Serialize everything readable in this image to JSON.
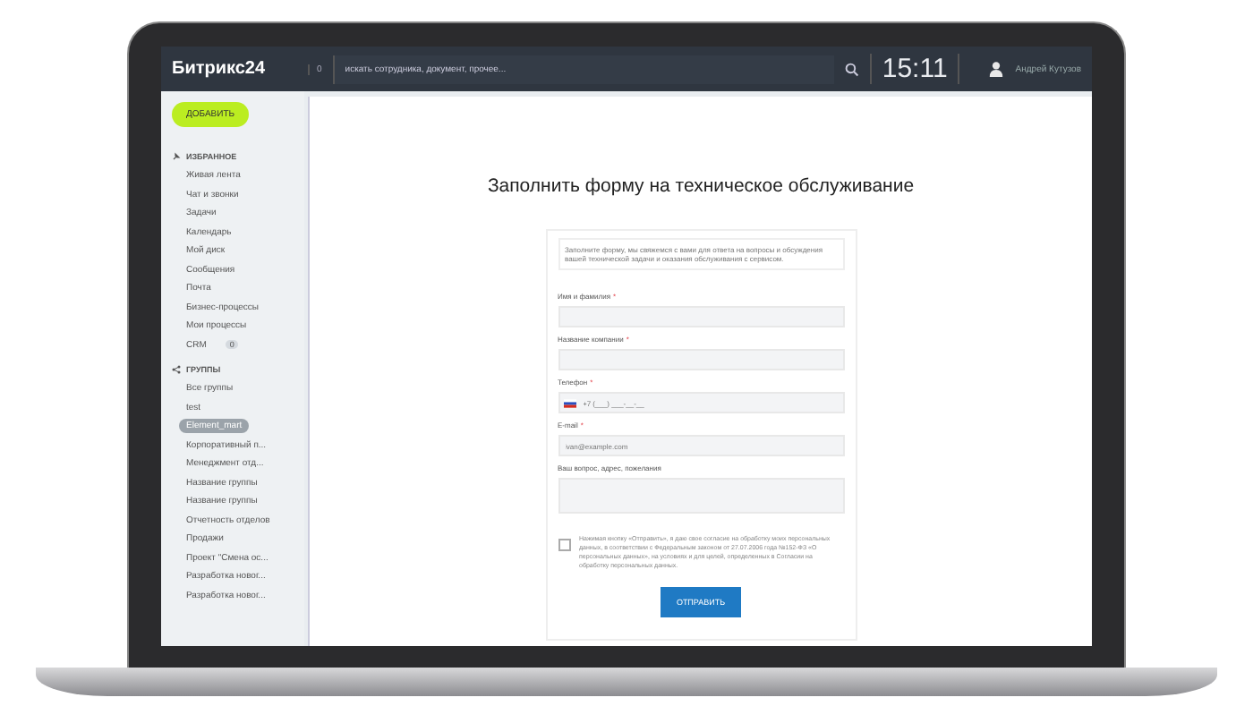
{
  "header": {
    "logo": "Битрикс24",
    "counter": "0",
    "search": {
      "placeholder": "искать сотрудника, документ, прочее..."
    },
    "time": "15:11",
    "user": "Андрей Кутузов"
  },
  "sidebar": {
    "add_button": "ДОБАВИТЬ",
    "sections": [
      {
        "title": "ИЗБРАННОЕ",
        "kind": "favorites",
        "items": [
          {
            "label": "Живая лента",
            "selected": false
          },
          {
            "label": "Чат и звонки",
            "selected": false
          },
          {
            "label": "Задачи",
            "selected": false
          },
          {
            "label": "Календарь",
            "selected": false
          },
          {
            "label": "Мой диск",
            "selected": false
          },
          {
            "label": "Сообщения",
            "selected": false
          },
          {
            "label": "Почта",
            "selected": false
          },
          {
            "label": "Бизнес-процессы",
            "selected": false
          },
          {
            "label": "Мои процессы",
            "selected": false
          },
          {
            "label": "CRM",
            "badge": "0",
            "selected": false
          }
        ]
      },
      {
        "title": "ГРУППЫ",
        "kind": "groups",
        "items": [
          {
            "label": "Все группы",
            "selected": false
          },
          {
            "label": "test",
            "selected": false
          },
          {
            "label": "Element_mart",
            "selected": true
          },
          {
            "label": "Корпоративный п...",
            "selected": false
          },
          {
            "label": "Менеджмент отд...",
            "selected": false
          },
          {
            "label": "Название группы",
            "selected": false
          },
          {
            "label": "Название группы",
            "selected": false
          },
          {
            "label": "Отчетность отделов",
            "selected": false
          },
          {
            "label": "Продажи",
            "selected": false
          },
          {
            "label": "Проект \"Смена ос...",
            "selected": false
          },
          {
            "label": "Разработка новог...",
            "selected": false
          },
          {
            "label": "Разработка новог...",
            "selected": false
          }
        ]
      }
    ]
  },
  "form": {
    "title": "Заполнить форму на техническое обслуживание",
    "intro": "Заполните форму, мы свяжемся с вами для ответа на вопросы и обсуждения вашей технической задачи и оказания обслуживания с сервисом.",
    "fields": [
      {
        "kind": "text",
        "label": "Имя и фамилия",
        "required_mark": "*"
      },
      {
        "kind": "text",
        "label": "Название компании",
        "required_mark": "*"
      },
      {
        "kind": "phone",
        "label": "Телефон",
        "required_mark": "*",
        "placeholder": "+7 (___) ___-__-__"
      },
      {
        "kind": "email",
        "label": "E-mail",
        "required_mark": "*",
        "placeholder": "ivan@example.com"
      },
      {
        "kind": "textarea",
        "label": "Ваш вопрос, адрес, пожелания"
      }
    ],
    "consent": {
      "checked": false,
      "text": "Нажимая кнопку «Отправить», я даю свое согласие на обработку моих персональных данных, в соответствии с Федеральным законом от 27.07.2006 года №152-ФЗ «О персональных данных», на условиях и для целей, определенных в Согласии на обработку персональных данных."
    },
    "submit": "ОТПРАВИТЬ"
  }
}
